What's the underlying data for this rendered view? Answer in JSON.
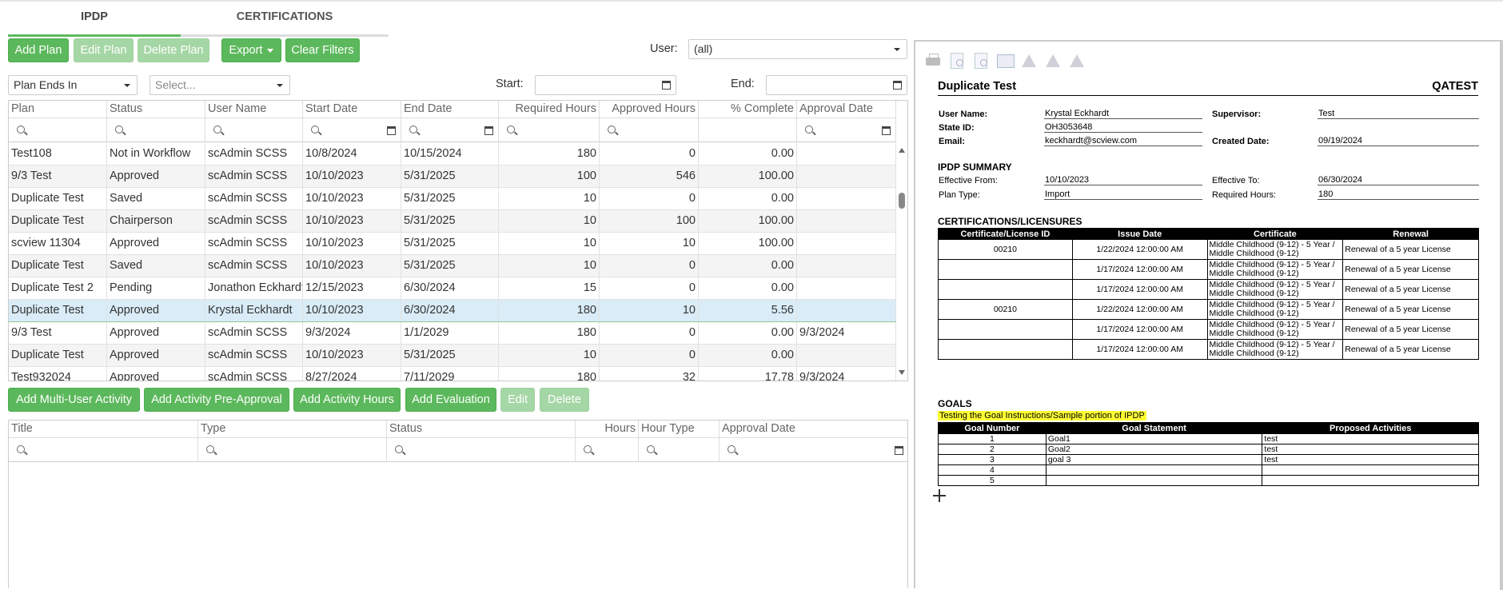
{
  "tabs": [
    {
      "label": "IPDP"
    },
    {
      "label": "CERTIFICATIONS"
    }
  ],
  "toolbar": {
    "add_plan": "Add Plan",
    "edit_plan": "Edit Plan",
    "delete_plan": "Delete Plan",
    "export": "Export",
    "clear_filters": "Clear Filters"
  },
  "filters": {
    "user_label": "User:",
    "user_value": "(all)",
    "plan_ends_value": "Plan Ends In",
    "select_placeholder": "Select...",
    "start_label": "Start:",
    "end_label": "End:"
  },
  "plans_grid": {
    "columns": [
      "Plan",
      "Status",
      "User Name",
      "Start Date",
      "End Date",
      "Required Hours",
      "Approved Hours",
      "% Complete",
      "Approval Date"
    ],
    "rows": [
      [
        "Test108",
        "Not in Workflow",
        "scAdmin SCSS",
        "10/8/2024",
        "10/15/2024",
        "180",
        "0",
        "0.00",
        ""
      ],
      [
        "9/3 Test",
        "Approved",
        "scAdmin SCSS",
        "10/10/2023",
        "5/31/2025",
        "100",
        "546",
        "100.00",
        ""
      ],
      [
        "Duplicate Test",
        "Saved",
        "scAdmin SCSS",
        "10/10/2023",
        "5/31/2025",
        "10",
        "0",
        "0.00",
        ""
      ],
      [
        "Duplicate Test",
        "Chairperson",
        "scAdmin SCSS",
        "10/10/2023",
        "5/31/2025",
        "10",
        "100",
        "100.00",
        ""
      ],
      [
        "scview 11304",
        "Approved",
        "scAdmin SCSS",
        "10/10/2023",
        "5/31/2025",
        "10",
        "10",
        "100.00",
        ""
      ],
      [
        "Duplicate Test",
        "Saved",
        "scAdmin SCSS",
        "10/10/2023",
        "5/31/2025",
        "10",
        "0",
        "0.00",
        ""
      ],
      [
        "Duplicate Test 2",
        "Pending",
        "Jonathon Eckhardt",
        "12/15/2023",
        "6/30/2024",
        "15",
        "0",
        "0.00",
        ""
      ],
      [
        "Duplicate Test",
        "Approved",
        "Krystal Eckhardt",
        "10/10/2023",
        "6/30/2024",
        "180",
        "10",
        "5.56",
        ""
      ],
      [
        "9/3 Test",
        "Approved",
        "scAdmin SCSS",
        "9/3/2024",
        "1/1/2029",
        "180",
        "0",
        "0.00",
        "9/3/2024"
      ],
      [
        "Duplicate Test",
        "Approved",
        "scAdmin SCSS",
        "10/10/2023",
        "5/31/2025",
        "10",
        "0",
        "0.00",
        ""
      ],
      [
        "Test932024",
        "Approved",
        "scAdmin SCSS",
        "8/27/2024",
        "7/11/2029",
        "180",
        "32",
        "17.78",
        "9/3/2024"
      ]
    ]
  },
  "activity_toolbar": {
    "add_multi": "Add Multi-User Activity",
    "add_preapproval": "Add Activity Pre-Approval",
    "add_hours": "Add Activity Hours",
    "add_evaluation": "Add Evaluation",
    "edit": "Edit",
    "delete": "Delete"
  },
  "activity_grid": {
    "columns": [
      "Title",
      "Type",
      "Status",
      "Hours",
      "Hour Type",
      "Approval Date"
    ]
  },
  "report": {
    "title": "Duplicate Test",
    "org": "QATEST",
    "user_name_label": "User Name:",
    "user_name": "Krystal Eckhardt",
    "supervisor_label": "Supervisor:",
    "supervisor": "Test",
    "state_id_label": "State ID:",
    "state_id": "OH3053648",
    "email_label": "Email:",
    "email": "keckhardt@scview.com",
    "created_label": "Created Date:",
    "created": "09/19/2024",
    "summary_title": "IPDP SUMMARY",
    "eff_from_label": "Effective From:",
    "eff_from": "10/10/2023",
    "eff_to_label": "Effective To:",
    "eff_to": "06/30/2024",
    "plan_type_label": "Plan Type:",
    "plan_type": "Import",
    "req_hours_label": "Required Hours:",
    "req_hours": "180",
    "cert_title": "CERTIFICATIONS/LICENSURES",
    "cert_columns": [
      "Certificate/License ID",
      "Issue Date",
      "Certificate",
      "Renewal"
    ],
    "cert_rows": [
      [
        "00210",
        "1/22/2024 12:00:00 AM",
        "Middle Childhood (9-12) - 5 Year / Middle Childhood (9-12)",
        "Renewal of a 5 year License"
      ],
      [
        "",
        "1/17/2024 12:00:00 AM",
        "Middle Childhood (9-12) - 5 Year / Middle Childhood (9-12)",
        "Renewal of a 5 year License"
      ],
      [
        "",
        "1/17/2024 12:00:00 AM",
        "Middle Childhood (9-12) - 5 Year / Middle Childhood (9-12)",
        "Renewal of a 5 year License"
      ],
      [
        "00210",
        "1/22/2024 12:00:00 AM",
        "Middle Childhood (9-12) - 5 Year / Middle Childhood (9-12)",
        "Renewal of a 5 year License"
      ],
      [
        "",
        "1/17/2024 12:00:00 AM",
        "Middle Childhood (9-12) - 5 Year / Middle Childhood (9-12)",
        "Renewal of a 5 year License"
      ],
      [
        "",
        "1/17/2024 12:00:00 AM",
        "Middle Childhood (9-12) - 5 Year / Middle Childhood (9-12)",
        "Renewal of a 5 year License"
      ]
    ],
    "goals_title": "GOALS",
    "goals_note": "Testing the Goal Instructions/Sample portion of IPDP",
    "goal_columns": [
      "Goal Number",
      "Goal Statement",
      "Proposed Activities"
    ],
    "goal_rows": [
      [
        "1",
        "Goal1",
        "test"
      ],
      [
        "2",
        "Goal2",
        "test"
      ],
      [
        "3",
        "goal 3",
        "test"
      ],
      [
        "4",
        "",
        ""
      ],
      [
        "5",
        "",
        ""
      ]
    ]
  }
}
